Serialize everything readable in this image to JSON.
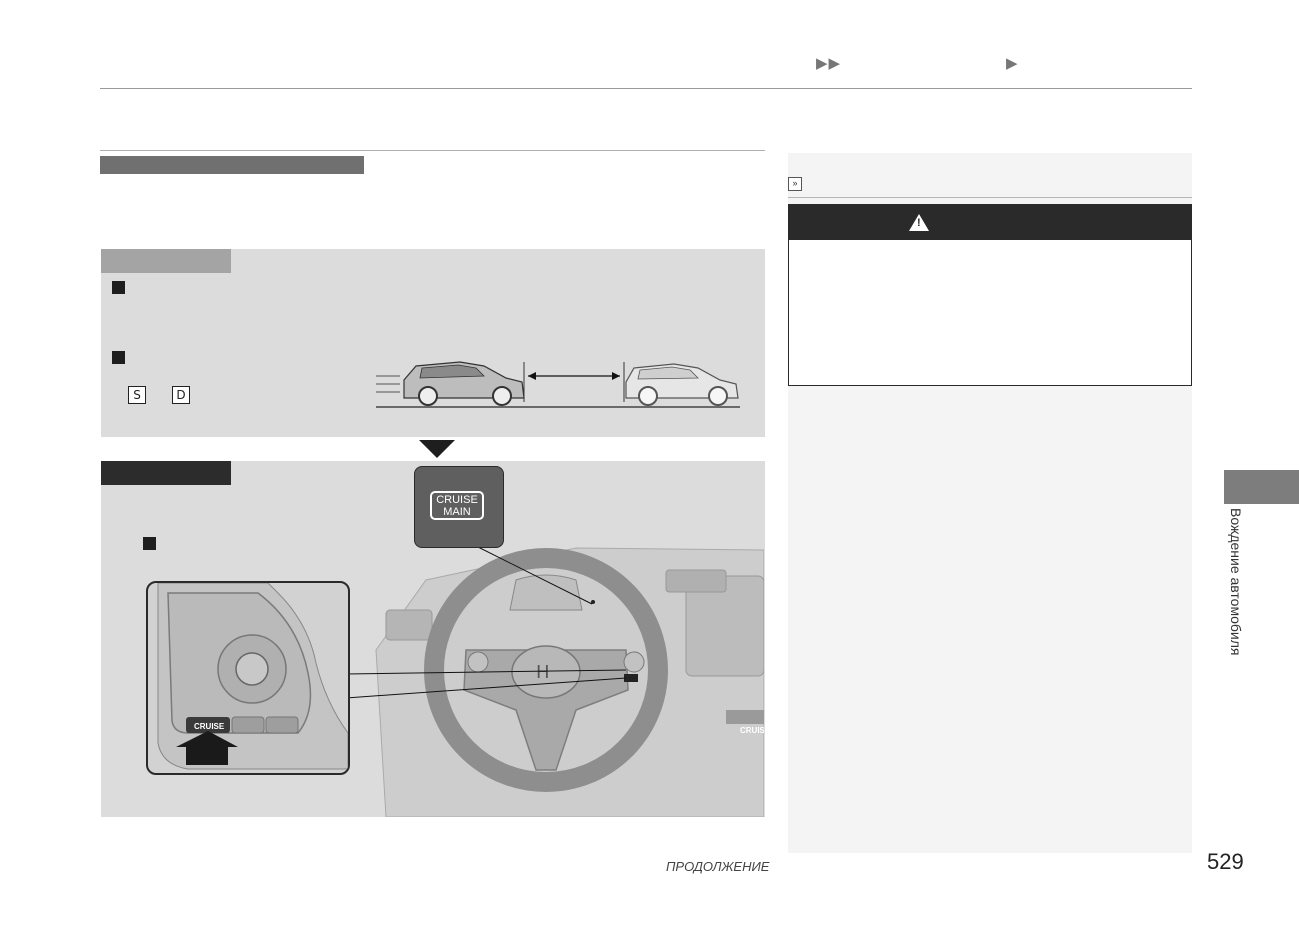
{
  "header": {
    "nav_arrows_double": "▶▶",
    "nav_arrow_single": "▶"
  },
  "panel_ready": {
    "gear_positions": [
      "S",
      "D"
    ]
  },
  "illustration": {
    "callout_label_line1": "CRUISE",
    "callout_label_line2": "MAIN",
    "inset_button_label": "CRUISE",
    "dash_button_label": "CRUIS"
  },
  "sidebar": {
    "ref_icon": "»"
  },
  "chapter": {
    "label": "Вождение автомобиля"
  },
  "footer": {
    "continue_label": "ПРОДОЛЖЕНИЕ",
    "page_number": "529"
  },
  "colors": {
    "panel_bg": "#dcdcdc",
    "tab_dark": "#2c2c2c",
    "tab_light": "#a4a4a4",
    "sidebar_bg": "#f4f4f4",
    "warning_header": "#2a2a2a"
  },
  "icons": [
    "warning-triangle-icon",
    "double-chevron-icon",
    "down-triangle-icon",
    "push-arrow-icon"
  ]
}
